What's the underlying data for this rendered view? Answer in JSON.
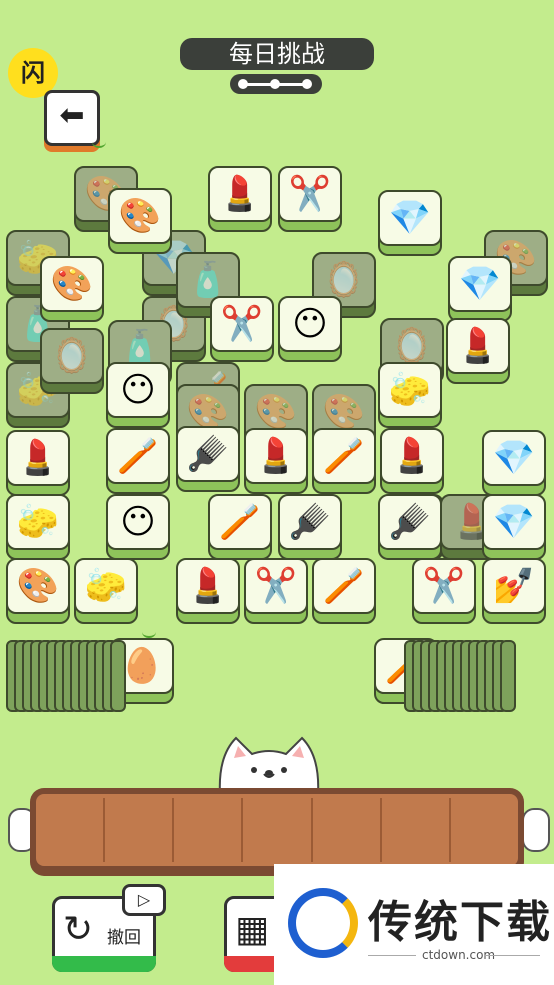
{
  "header": {
    "title": "每日挑战",
    "badge_text": "闪",
    "back_icon": "arrow-left-icon"
  },
  "progress": {
    "stages_total": 3,
    "stage_current": 1
  },
  "tile_symbols": {
    "palette": "🎨",
    "lipstick": "💄",
    "scissors": "✂️",
    "diamond": "💎",
    "mirror": "🪞",
    "perfume": "🧴",
    "mask": "😶",
    "compact": "🧽",
    "toothbrush": "🪥",
    "comb": "🪮",
    "nail": "💅",
    "sponge": "🥚"
  },
  "tiles_bottom": [
    {
      "sym": "palette",
      "dim": true
    },
    {
      "sym": "compact",
      "dim": true
    },
    {
      "sym": "diamond",
      "dim": true
    },
    {
      "sym": "palette",
      "dim": true
    },
    {
      "sym": "perfume",
      "dim": true
    },
    {
      "sym": "mirror",
      "dim": true
    },
    {
      "sym": "perfume",
      "dim": true
    },
    {
      "sym": "mirror",
      "dim": true
    },
    {
      "sym": "compact",
      "dim": true
    },
    {
      "sym": "mirror",
      "dim": true
    },
    {
      "sym": "perfume",
      "dim": true
    },
    {
      "sym": "mirror",
      "dim": true
    },
    {
      "sym": "compact",
      "dim": true
    },
    {
      "sym": "toothbrush",
      "dim": true
    },
    {
      "sym": "palette",
      "dim": true
    },
    {
      "sym": "palette",
      "dim": true
    },
    {
      "sym": "palette",
      "dim": true
    },
    {
      "sym": "mask",
      "dim": true
    },
    {
      "sym": "lipstick",
      "dim": true
    }
  ],
  "tiles_top": [
    {
      "sym": "palette"
    },
    {
      "sym": "lipstick"
    },
    {
      "sym": "scissors"
    },
    {
      "sym": "diamond"
    },
    {
      "sym": "palette"
    },
    {
      "sym": "scissors"
    },
    {
      "sym": "mask"
    },
    {
      "sym": "diamond"
    },
    {
      "sym": "lipstick"
    },
    {
      "sym": "mask"
    },
    {
      "sym": "compact"
    },
    {
      "sym": "lipstick"
    },
    {
      "sym": "toothbrush"
    },
    {
      "sym": "comb"
    },
    {
      "sym": "lipstick"
    },
    {
      "sym": "toothbrush"
    },
    {
      "sym": "lipstick"
    },
    {
      "sym": "diamond"
    },
    {
      "sym": "compact"
    },
    {
      "sym": "mask"
    },
    {
      "sym": "toothbrush"
    },
    {
      "sym": "comb"
    },
    {
      "sym": "comb"
    },
    {
      "sym": "diamond"
    },
    {
      "sym": "palette"
    },
    {
      "sym": "compact"
    },
    {
      "sym": "lipstick"
    },
    {
      "sym": "scissors"
    },
    {
      "sym": "toothbrush"
    },
    {
      "sym": "scissors"
    },
    {
      "sym": "nail"
    },
    {
      "sym": "sponge"
    },
    {
      "sym": "toothbrush"
    }
  ],
  "tray": {
    "slots": 7,
    "filled": 0
  },
  "buttons": {
    "undo": {
      "label": "撤回",
      "icon": "undo-icon"
    },
    "shuffle": {
      "icon": "grid-icon"
    },
    "video_icon": "video-play-icon"
  },
  "watermark": {
    "title": "传统下载",
    "url": "ctdown.com"
  }
}
